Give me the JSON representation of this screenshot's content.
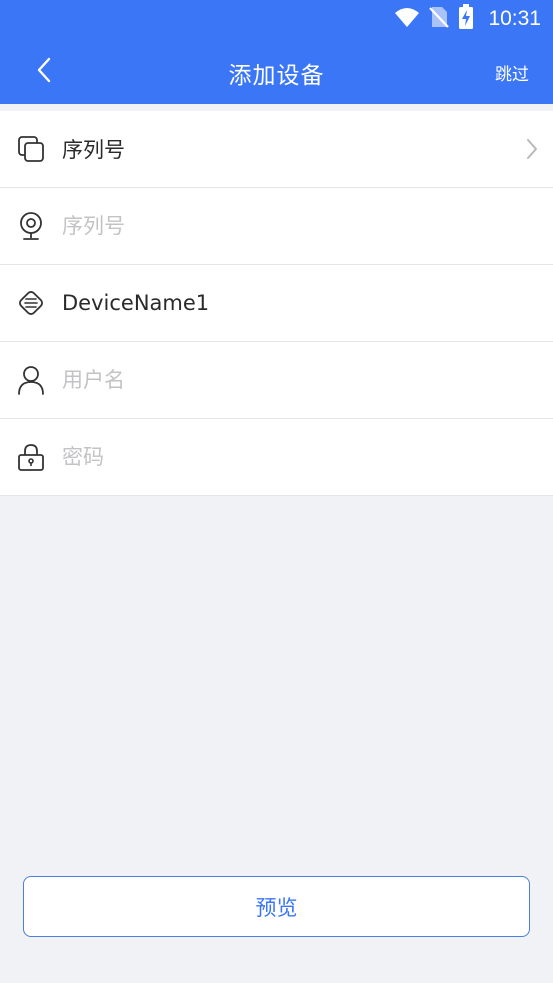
{
  "status_bar": {
    "time": "10:31",
    "icons": [
      "wifi-icon",
      "no-sim-icon",
      "battery-charging-icon"
    ]
  },
  "app_bar": {
    "title": "添加设备",
    "back_icon": "chevron-left-icon",
    "skip_label": "跳过"
  },
  "form": {
    "rows": [
      {
        "icon": "device-type-icon",
        "text": "序列号",
        "is_placeholder": false,
        "has_chevron": true
      },
      {
        "icon": "camera-icon",
        "placeholder": "序列号",
        "value": ""
      },
      {
        "icon": "tag-icon",
        "value": "DeviceName1"
      },
      {
        "icon": "user-icon",
        "placeholder": "用户名",
        "value": ""
      },
      {
        "icon": "lock-icon",
        "placeholder": "密码",
        "value": ""
      }
    ]
  },
  "preview_button": {
    "label": "预览"
  },
  "colors": {
    "primary": "#3b76f6",
    "background": "#f1f2f6",
    "placeholder": "#c3c3c6",
    "text": "#2a2a2a"
  }
}
